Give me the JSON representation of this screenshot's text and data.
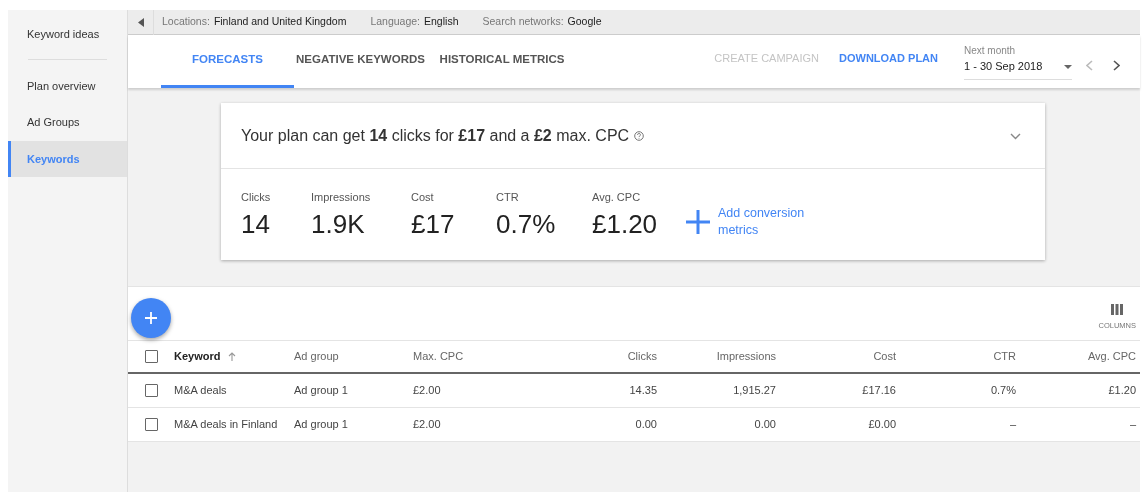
{
  "sidebar": {
    "items": [
      {
        "label": "Keyword ideas",
        "selected": false
      },
      {
        "label": "Plan overview",
        "selected": false
      },
      {
        "label": "Ad Groups",
        "selected": false
      },
      {
        "label": "Keywords",
        "selected": true
      }
    ]
  },
  "filters": [
    {
      "label": "Locations:",
      "value": "Finland and United Kingdom"
    },
    {
      "label": "Language:",
      "value": "English"
    },
    {
      "label": "Search networks:",
      "value": "Google"
    }
  ],
  "tabs": [
    {
      "label": "FORECASTS",
      "selected": true
    },
    {
      "label": "NEGATIVE KEYWORDS",
      "selected": false
    },
    {
      "label": "HISTORICAL METRICS",
      "selected": false
    }
  ],
  "actions": [
    {
      "label": "CREATE CAMPAIGN",
      "disabled": true
    },
    {
      "label": "DOWNLOAD PLAN",
      "disabled": false
    }
  ],
  "date_range": {
    "label": "Next month",
    "value": "1 - 30 Sep 2018"
  },
  "summary": {
    "headline": "Your plan can get **14** clicks for **£17** and a **£2** max. CPC",
    "metrics": [
      {
        "label": "Clicks",
        "value": "14"
      },
      {
        "label": "Impressions",
        "value": "1.9K"
      },
      {
        "label": "Cost",
        "value": "£17"
      },
      {
        "label": "CTR",
        "value": "0.7%"
      },
      {
        "label": "Avg. CPC",
        "value": "£1.20"
      }
    ],
    "add_link": "Add conversion metrics"
  },
  "columns_button": "COLUMNS",
  "table": {
    "all_checked": false,
    "columns": [
      "Keyword",
      "Ad group",
      "Max. CPC",
      "Clicks",
      "Impressions",
      "Cost",
      "CTR",
      "Avg. CPC"
    ],
    "rows": [
      {
        "checked": false,
        "cells": [
          "M&A deals",
          "Ad group 1",
          "£2.00",
          "14.35",
          "1,915.27",
          "£17.16",
          "0.7%",
          "£1.20"
        ]
      },
      {
        "checked": false,
        "cells": [
          "M&A deals in Finland",
          "Ad group 1",
          "£2.00",
          "0.00",
          "0.00",
          "£0.00",
          "–",
          "–"
        ]
      }
    ]
  }
}
